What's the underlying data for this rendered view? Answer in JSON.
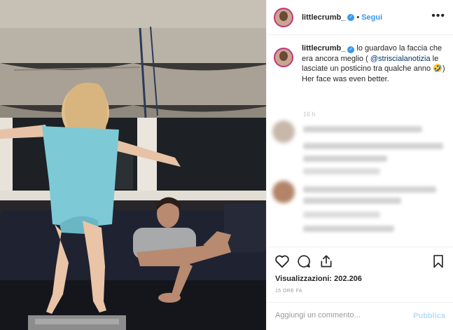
{
  "post": {
    "username": "littlecrumb_",
    "verified_badge": "✓",
    "separator": "•",
    "follow_label": "Segui",
    "more_glyph": "•••"
  },
  "caption": {
    "username": "littlecrumb_",
    "text_1": "lo guardavo la faccia che era ancora meglio (",
    "mention": "@striscialanotizia",
    "text_2": "le lasciate un posticino tra qualche anno 🤣) Her face was even better.",
    "time_small": "16 h"
  },
  "comments_visible": 3,
  "actions": {
    "like_icon": "heart-icon",
    "comment_icon": "comment-icon",
    "share_icon": "share-icon",
    "save_icon": "bookmark-icon"
  },
  "stats": {
    "views_label": "Visualizzazioni:",
    "views_value": "202.206",
    "time_ago": "15 ORE FA"
  },
  "comment_box": {
    "placeholder": "Aggiungi un commento...",
    "publish_label": "Pubblica"
  },
  "colors": {
    "accent": "#3897f0",
    "publish_disabled": "#b2dffc",
    "border": "#efefef"
  }
}
